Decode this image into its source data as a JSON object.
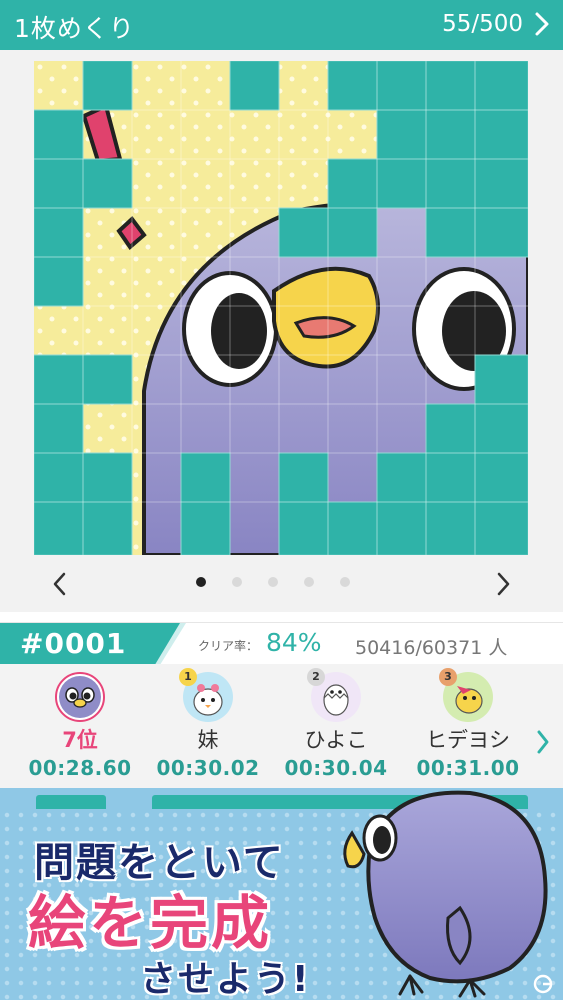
{
  "header": {
    "title": "1枚めくり",
    "progress": "55/500"
  },
  "puzzle": {
    "pager": {
      "dot_count": 5,
      "active_index": 0
    }
  },
  "stats": {
    "puzzle_number": "#0001",
    "clear_rate_label": "クリア率：",
    "clear_rate_value": "84%",
    "counts": "50416/60371 人"
  },
  "ranking": [
    {
      "rank_label": "7位",
      "time": "00:28.60",
      "is_self": true,
      "medal": ""
    },
    {
      "rank_label": "妹",
      "time": "00:30.02",
      "is_self": false,
      "medal": "1"
    },
    {
      "rank_label": "ひよこ",
      "time": "00:30.04",
      "is_self": false,
      "medal": "2"
    },
    {
      "rank_label": "ヒデヨシ",
      "time": "00:31.00",
      "is_self": false,
      "medal": "3"
    }
  ],
  "promo": {
    "line1": "問題をといて",
    "line2": "絵を完成",
    "line3": "させよう!"
  },
  "colors": {
    "accent": "#2fb3a8",
    "highlight": "#e8457a",
    "tile": "#2fb3a8",
    "yellow": "#f6ec9b",
    "purple": "#8f8cc7"
  }
}
